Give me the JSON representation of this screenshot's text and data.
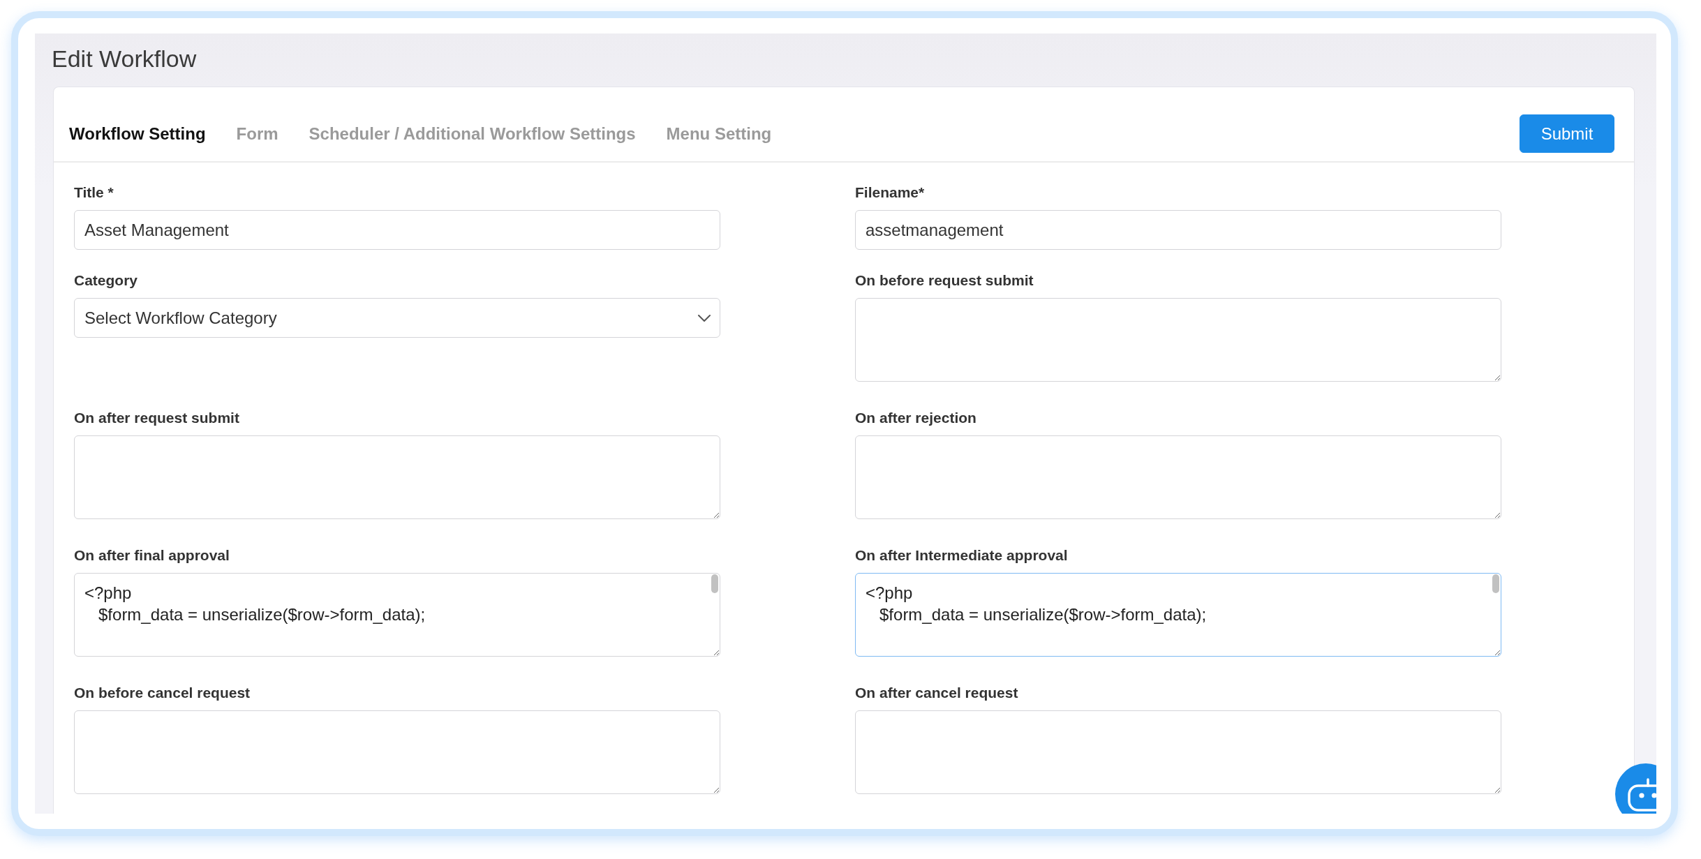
{
  "page": {
    "title": "Edit Workflow"
  },
  "tabs": [
    {
      "label": "Workflow Setting",
      "selected": true
    },
    {
      "label": "Form",
      "selected": false
    },
    {
      "label": "Scheduler / Additional Workflow Settings",
      "selected": false
    },
    {
      "label": "Menu Setting",
      "selected": false
    }
  ],
  "submit_button": "Submit",
  "fields": [
    {
      "kind": "input",
      "label": "Title *",
      "value": "Asset Management",
      "focused": false
    },
    {
      "kind": "input",
      "label": "Filename*",
      "value": "assetmanagement",
      "focused": false
    },
    {
      "kind": "select",
      "label": "Category",
      "value": "Select Workflow Category",
      "focused": false
    },
    {
      "kind": "textarea",
      "label": "On before request submit",
      "focused": false
    },
    {
      "kind": "textarea",
      "label": "On after request submit",
      "focused": false
    },
    {
      "kind": "textarea",
      "label": "On after rejection",
      "focused": false
    },
    {
      "kind": "code",
      "label": "On after final approval",
      "value": "<?php\n   $form_data = unserialize($row->form_data);",
      "focused": false
    },
    {
      "kind": "code",
      "label": "On after Intermediate approval",
      "value": "<?php\n   $form_data = unserialize($row->form_data);",
      "focused": true
    },
    {
      "kind": "textarea",
      "label": "On before cancel request",
      "focused": false
    },
    {
      "kind": "textarea",
      "label": "On after cancel request",
      "focused": false
    }
  ]
}
